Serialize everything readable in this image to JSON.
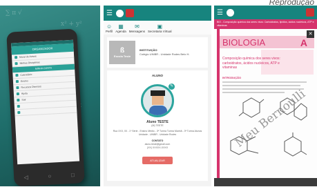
{
  "caption": "Reprodução",
  "panel1": {
    "screen_title": "ORGANIZADOR",
    "highlight": "MINHA CONTA",
    "menu_items": [
      "Mural de Avisos",
      "Minhas Disciplinas",
      "",
      "Calendário",
      "Ensino",
      "Recursos Diversos",
      "Ajuda",
      "Sair",
      "",
      ""
    ]
  },
  "panel2": {
    "nav": [
      {
        "label": "Perfil",
        "glyph": "☺"
      },
      {
        "label": "Agenda",
        "glyph": "▦"
      },
      {
        "label": "Mensagens",
        "glyph": "✉"
      },
      {
        "label": "Secretaria Virtual",
        "glyph": "▣"
      }
    ],
    "institution": {
      "logo_text": "Escola Teste",
      "heading": "INSTITUIÇÃO",
      "detail": "Colégio UNIBR - Unidade Rodes Belo H."
    },
    "student": {
      "heading": "ALUNO",
      "name": "Aluno TESTE",
      "subtitle": "(M) TESTE",
      "info": "Rua XXX, 00 - 1º Série - Ensino Médio - 3ª Turma Turma Manhã - 3ª Turma Alunos Unidade - UNIBR - Unidade Rodes",
      "contact_heading": "CONTATO",
      "email": "aluno.teste@gmail.com",
      "phone": "(XX) XXXXX-XXXX",
      "save_button": "ATUALIZAR"
    }
  },
  "panel3": {
    "crumb": "BIO - Composição química dos seres vivos: Carboidratos, lipídios, ácidos nucleicos, ATP e vitaminas",
    "subject": "BIOLOGIA",
    "volume": "A",
    "title": "Composição química dos seres vivos: carboidratos, ácidos nucleicos, ATP e vitaminas",
    "section": "INTRODUÇÃO",
    "watermark": "Meu Bernoulli"
  },
  "colors": {
    "teal": "#17847e",
    "pink": "#d6336c",
    "save": "#e56b66"
  }
}
